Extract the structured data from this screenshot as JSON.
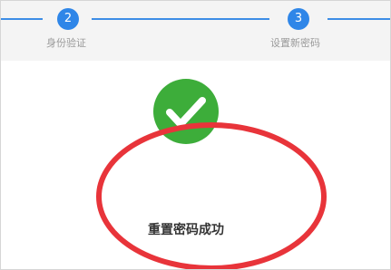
{
  "stepper": {
    "steps": [
      {
        "number": "2",
        "label": "身份验证"
      },
      {
        "number": "3",
        "label": "设置新密码"
      }
    ],
    "accent_color": "#2f86e8"
  },
  "result": {
    "icon": "checkmark-circle-icon",
    "message": "重置密码成功",
    "color": "#3dad3a"
  },
  "annotation": {
    "shape": "ellipse",
    "color": "#e8343a"
  }
}
